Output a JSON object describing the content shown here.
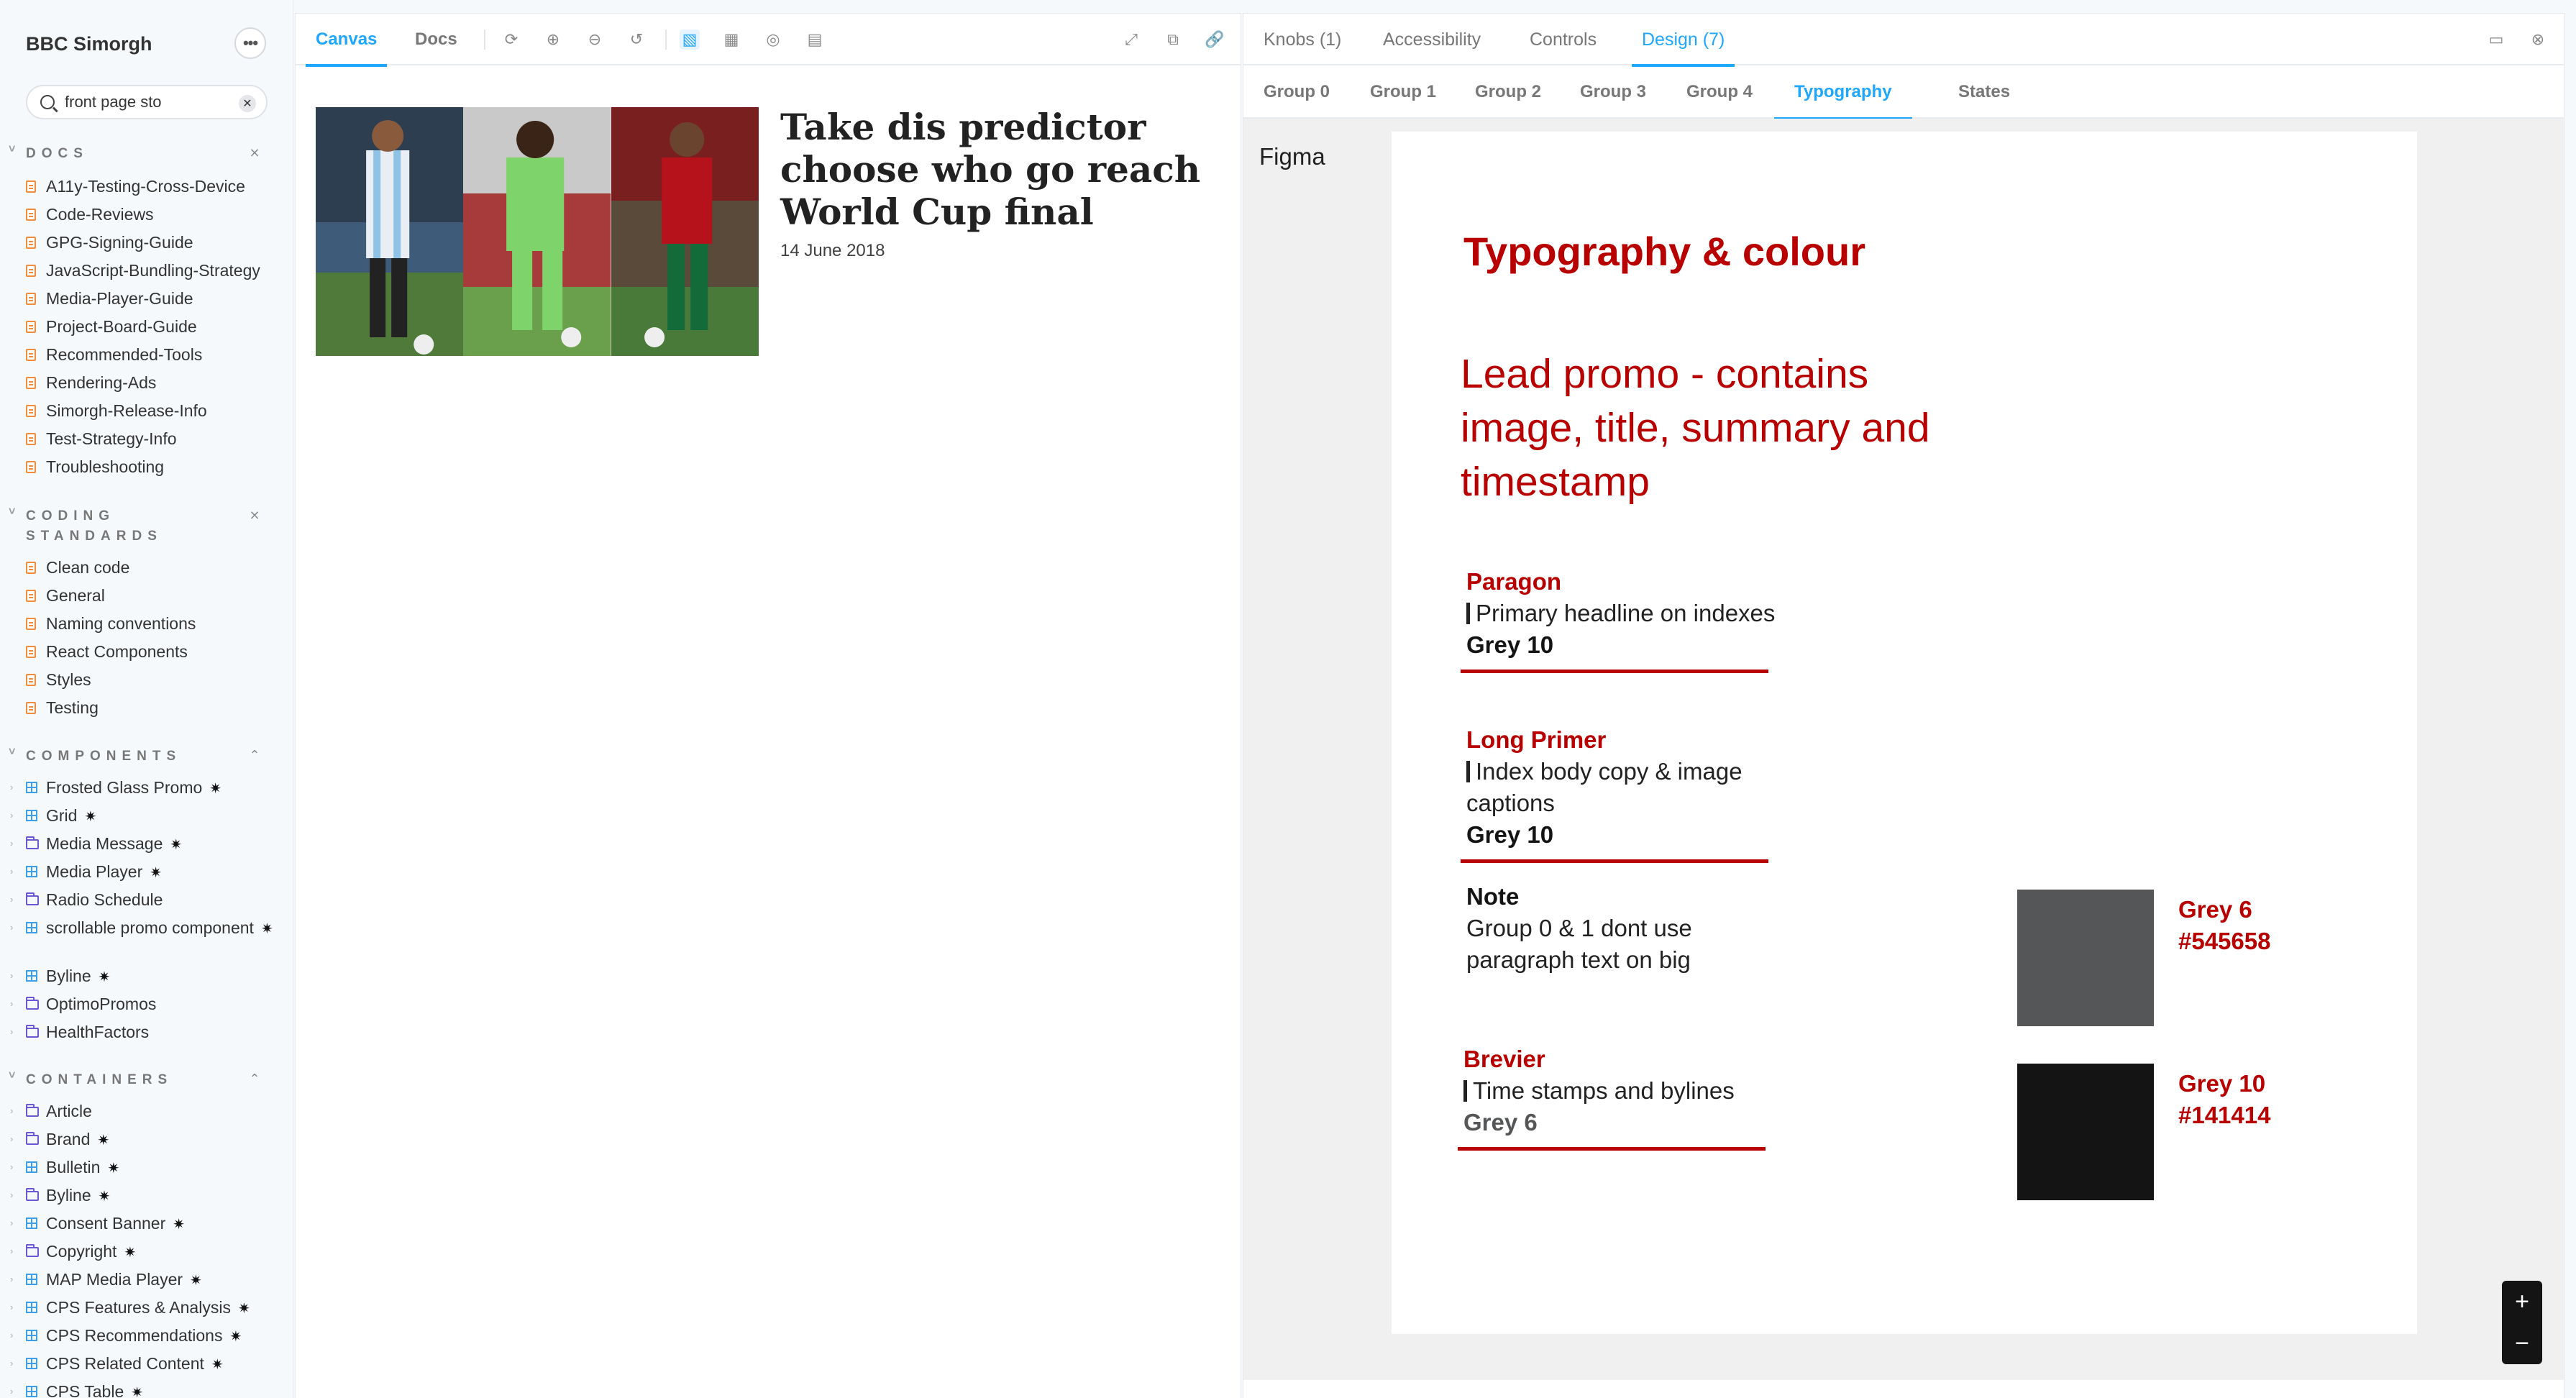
{
  "sidebar": {
    "title": "BBC Simorgh",
    "search_value": "front page sto",
    "sections": {
      "docs": {
        "label": "DOCS",
        "items": [
          "A11y-Testing-Cross-Device",
          "Code-Reviews",
          "GPG-Signing-Guide",
          "JavaScript-Bundling-Strategy",
          "Media-Player-Guide",
          "Project-Board-Guide",
          "Recommended-Tools",
          "Rendering-Ads",
          "Simorgh-Release-Info",
          "Test-Strategy-Info",
          "Troubleshooting"
        ]
      },
      "coding": {
        "label_line1": "CODING",
        "label_line2": "STANDARDS",
        "items": [
          "Clean code",
          "General",
          "Naming conventions",
          "React Components",
          "Styles",
          "Testing"
        ]
      },
      "components": {
        "label": "COMPONENTS",
        "items": [
          {
            "label": "Frosted Glass Promo",
            "icon": "component",
            "puzzle": true
          },
          {
            "label": "Grid",
            "icon": "component",
            "puzzle": true
          },
          {
            "label": "Media Message",
            "icon": "folder",
            "puzzle": true
          },
          {
            "label": "Media Player",
            "icon": "component",
            "puzzle": true
          },
          {
            "label": "Radio Schedule",
            "icon": "folder",
            "puzzle": false
          },
          {
            "label": "scrollable promo component",
            "icon": "component",
            "puzzle": true
          },
          {
            "label": "Byline",
            "icon": "component",
            "puzzle": true
          },
          {
            "label": "OptimoPromos",
            "icon": "folder",
            "puzzle": false
          },
          {
            "label": "HealthFactors",
            "icon": "folder",
            "puzzle": false
          }
        ]
      },
      "containers": {
        "label": "CONTAINERS",
        "items": [
          {
            "label": "Article",
            "icon": "folder",
            "puzzle": false
          },
          {
            "label": "Brand",
            "icon": "folder",
            "puzzle": true
          },
          {
            "label": "Bulletin",
            "icon": "component",
            "puzzle": true
          },
          {
            "label": "Byline",
            "icon": "folder",
            "puzzle": true
          },
          {
            "label": "Consent Banner",
            "icon": "component",
            "puzzle": true
          },
          {
            "label": "Copyright",
            "icon": "folder",
            "puzzle": true
          },
          {
            "label": "MAP Media Player",
            "icon": "component",
            "puzzle": true
          },
          {
            "label": "CPS Features & Analysis",
            "icon": "component",
            "puzzle": true
          },
          {
            "label": "CPS Recommendations",
            "icon": "component",
            "puzzle": true
          },
          {
            "label": "CPS Related Content",
            "icon": "component",
            "puzzle": true
          },
          {
            "label": "CPS Table",
            "icon": "component",
            "puzzle": true
          }
        ]
      }
    }
  },
  "canvas": {
    "tabs": [
      "Canvas",
      "Docs"
    ],
    "promo_title": "Take dis predictor choose who go reach World Cup final",
    "promo_date": "14 June 2018"
  },
  "addons": {
    "tabs": [
      "Knobs (1)",
      "Accessibility",
      "Controls",
      "Design (7)"
    ],
    "subtabs": [
      "Group 0",
      "Group 1",
      "Group 2",
      "Group 3",
      "Group 4",
      "Typography",
      "States"
    ],
    "figma_label": "Figma",
    "design": {
      "heading": "Typography & colour",
      "lead": "Lead promo - contains image, title, summary and timestamp",
      "paragon": {
        "name": "Paragon",
        "desc": "Primary headline on indexes",
        "grey": "Grey 10"
      },
      "long_primer": {
        "name": "Long Primer",
        "desc": "Index body copy & image captions",
        "grey": "Grey 10"
      },
      "note": {
        "name": "Note",
        "desc": "Group 0 & 1 dont use paragraph text on big"
      },
      "brevier": {
        "name": "Brevier",
        "desc": "Time stamps and bylines",
        "grey": "Grey 6"
      },
      "swatches": [
        {
          "name": "Grey 6",
          "hex": "#545658"
        },
        {
          "name": "Grey 10",
          "hex": "#141414"
        }
      ]
    }
  },
  "colors": {
    "accent": "#1ea7fd",
    "bbc_red": "#b80000"
  }
}
